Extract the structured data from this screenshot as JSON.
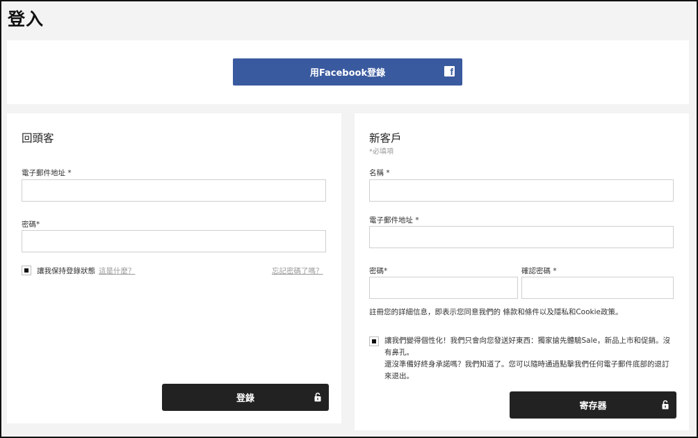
{
  "page": {
    "title": "登入"
  },
  "facebook": {
    "button_label": "用Facebook登錄",
    "icon": "facebook-icon"
  },
  "returning": {
    "title": "回頭客",
    "email_label": "電子郵件地址 *",
    "email_value": "",
    "password_label": "密碼*",
    "password_value": "",
    "remember_label": "讓我保持登錄狀態",
    "whats_this": "這是什麼？",
    "forgot_password": "忘記密碼了嗎？",
    "login_button": "登錄",
    "remember_checked": true
  },
  "new_customer": {
    "title": "新客戶",
    "required_note": "*必填項",
    "name_label": "名稱 *",
    "name_value": "",
    "email_label": "電子郵件地址 *",
    "email_value": "",
    "password_label": "密碼*",
    "password_value": "",
    "confirm_label": "確認密碼 *",
    "confirm_value": "",
    "terms_text": "註冊您的詳細信息，即表示您同意我們的 條款和條件以及隱私和Cookie政策。",
    "personalize_line1": "讓我們變得個性化！我們只會向您發送好東西：獨家搶先體驗Sale，新品上市和促銷。沒有鼻孔。",
    "personalize_line2": "還沒準備好終身承諾嗎？我們知道了。您可以隨時通過點擊我們任何電子郵件底部的退訂來退出。",
    "personalize_checked": true,
    "register_button": "寄存器"
  },
  "colors": {
    "facebook": "#3a5a9f",
    "button_dark": "#222222",
    "background": "#f3f3f3"
  }
}
